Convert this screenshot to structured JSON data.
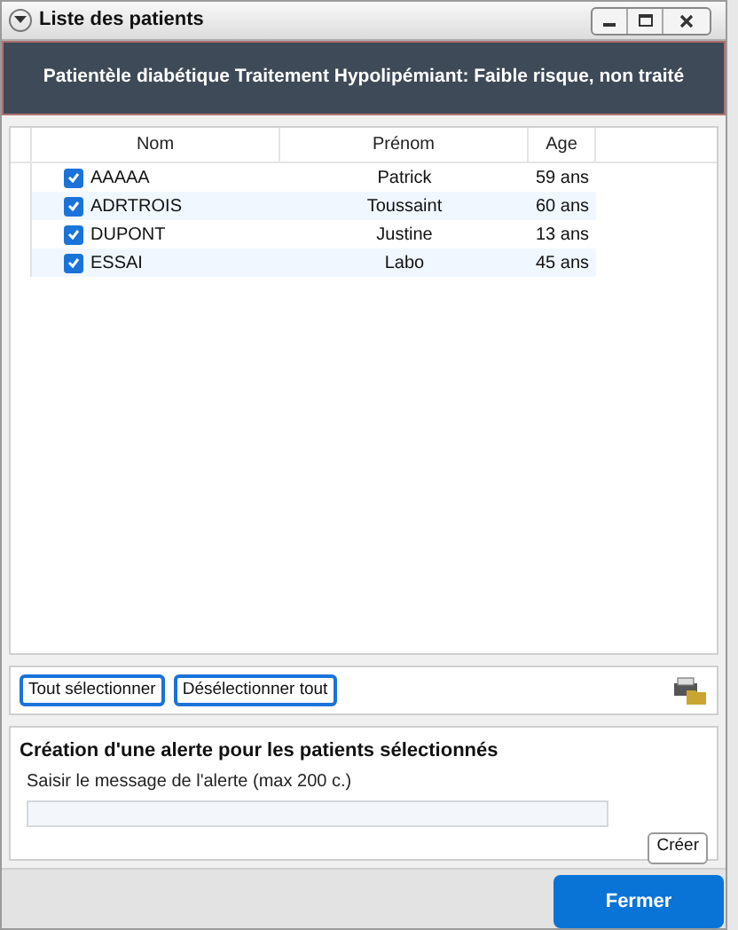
{
  "window": {
    "title": "Liste des patients"
  },
  "header": "Patientèle diabétique Traitement Hypolipémiant: Faible risque, non traité",
  "table": {
    "columns": [
      "Nom",
      "Prénom",
      "Age"
    ],
    "rows": [
      {
        "nom": "AAAAA",
        "prenom": "Patrick",
        "age": "59 ans",
        "checked": true
      },
      {
        "nom": "ADRTROIS",
        "prenom": "Toussaint",
        "age": "60 ans",
        "checked": true
      },
      {
        "nom": "DUPONT",
        "prenom": "Justine",
        "age": "13 ans",
        "checked": true
      },
      {
        "nom": "ESSAI",
        "prenom": "Labo",
        "age": "45 ans",
        "checked": true
      }
    ]
  },
  "selection_buttons": [
    "Tout sélectionner",
    "Désélectionner tout"
  ],
  "alert": {
    "title": "Création d'une alerte pour les patients sélectionnés",
    "label": "Saisir le message de l'alerte (max 200 c.)",
    "button": "Créer"
  },
  "close_button": "Fermer"
}
